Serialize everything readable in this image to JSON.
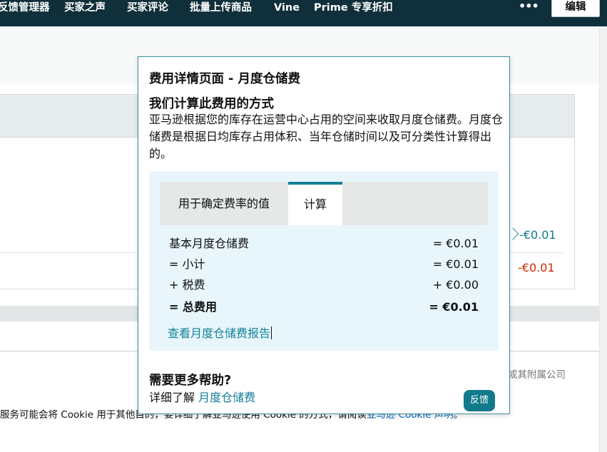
{
  "nav": {
    "items": [
      "反馈管理器",
      "买家之声",
      "买家评论",
      "批量上传商品",
      "Vine",
      "Prime 专享折扣"
    ],
    "more_glyph": "•••",
    "edit_label": "编辑"
  },
  "background": {
    "value_1": "-€0.01",
    "value_2": "-€0.01",
    "copyright": "或其附属公司",
    "cookie_text": "服务可能会将 Cookie 用于其他目的，要详细了解亚马逊使用 Cookie 的方式，请阅读",
    "cookie_link": "亚马逊 Cookie 声明",
    "cookie_end": "。"
  },
  "popover": {
    "title": "费用详情页面 - 月度仓储费",
    "subtitle": "我们计算此费用的方式",
    "description": "亚马逊根据您的库存在运营中心占用的空间来收取月度仓储费。月度仓储费是根据日均库存占用体积、当年仓储时间以及可分类性计算得出的。",
    "tabs": [
      {
        "label": "用于确定费率的值"
      },
      {
        "label": "计算"
      }
    ],
    "rows": [
      {
        "label": "基本月度仓储费",
        "value": "= €0.01"
      },
      {
        "label": "= 小计",
        "value": "= €0.01"
      },
      {
        "label": "+ 税费",
        "value": "+ €0.00"
      },
      {
        "label": "= 总费用",
        "value": "= €0.01"
      }
    ],
    "report_link": "查看月度仓储费报告",
    "help_title": "需要更多帮助?",
    "help_prefix": "详细了解",
    "help_link": "月度仓储费",
    "feedback_label": "反馈"
  },
  "colors": {
    "nav_bg": "#0f2f3a",
    "accent": "#138196",
    "negative": "#cc2a00",
    "calc_bg": "#e8f6fc"
  }
}
